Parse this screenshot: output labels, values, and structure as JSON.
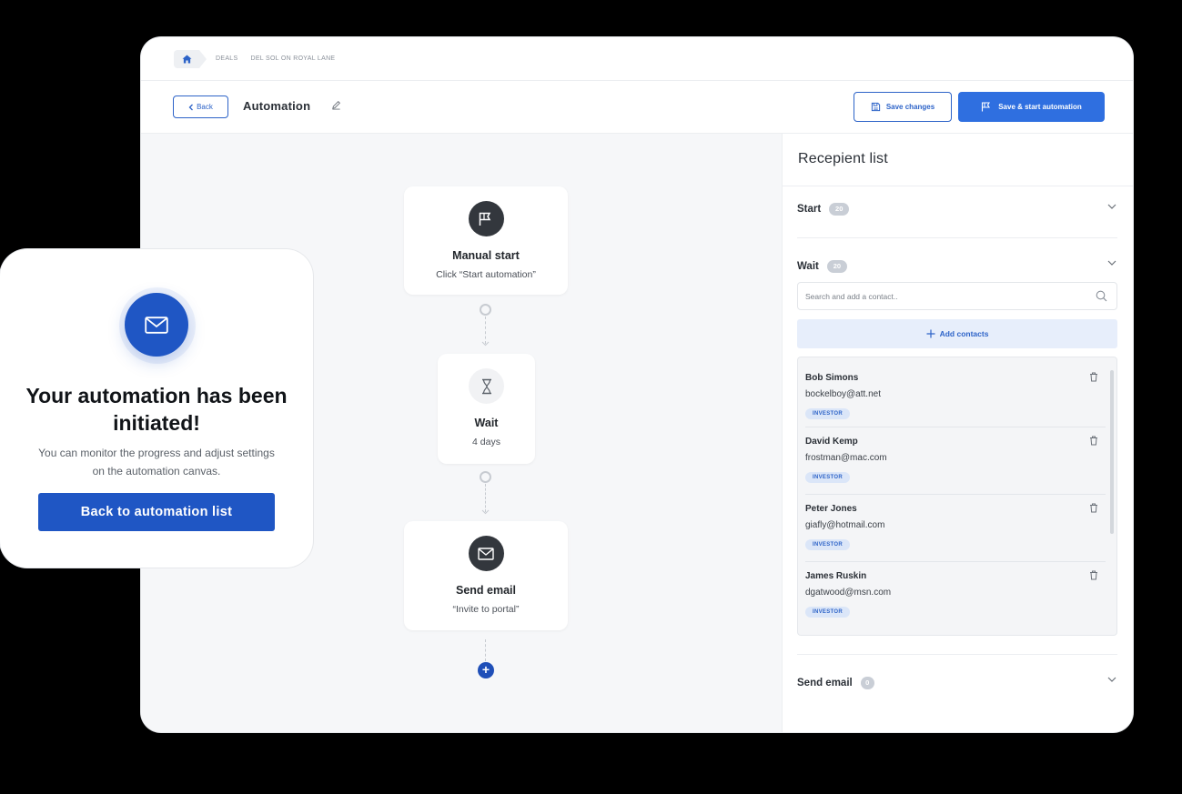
{
  "breadcrumb": {
    "items": [
      "DEALS",
      "DEL SOL ON ROYAL LANE"
    ]
  },
  "toolbar": {
    "back_label": "Back",
    "title": "Automation",
    "save_label": "Save changes",
    "start_label": "Save & start automation"
  },
  "canvas": {
    "nodes": [
      {
        "title": "Manual start",
        "subtitle": "Click “Start automation”",
        "icon": "flag-icon"
      },
      {
        "title": "Wait",
        "subtitle": "4 days",
        "icon": "hourglass-icon"
      },
      {
        "title": "Send email",
        "subtitle": "“Invite to portal”",
        "icon": "envelope-icon"
      }
    ],
    "add_label": "+"
  },
  "panel": {
    "title": "Recepient list",
    "sections": [
      {
        "label": "Start",
        "count": "20"
      },
      {
        "label": "Wait",
        "count": "20"
      },
      {
        "label": "Send email",
        "count": "0"
      }
    ],
    "search_placeholder": "Search and add a contact..",
    "add_contacts_label": "Add contacts",
    "contacts": [
      {
        "name": "Bob Simons",
        "email": "bockelboy@att.net",
        "role": "INVESTOR"
      },
      {
        "name": "David Kemp",
        "email": "frostman@mac.com",
        "role": "INVESTOR"
      },
      {
        "name": "Peter Jones",
        "email": "giafly@hotmail.com",
        "role": "INVESTOR"
      },
      {
        "name": "James Ruskin",
        "email": "dgatwood@msn.com",
        "role": "INVESTOR"
      }
    ]
  },
  "toast": {
    "title": "Your automation has been initiated!",
    "body": "You can monitor the progress and adjust settings on the automation canvas.",
    "button_label": "Back to automation list"
  },
  "colors": {
    "primary": "#2f6fe0",
    "primary_dark": "#1f56c4",
    "node_icon": "#33373d",
    "canvas_bg": "#f6f7f9",
    "badge": "#c9ced6"
  }
}
